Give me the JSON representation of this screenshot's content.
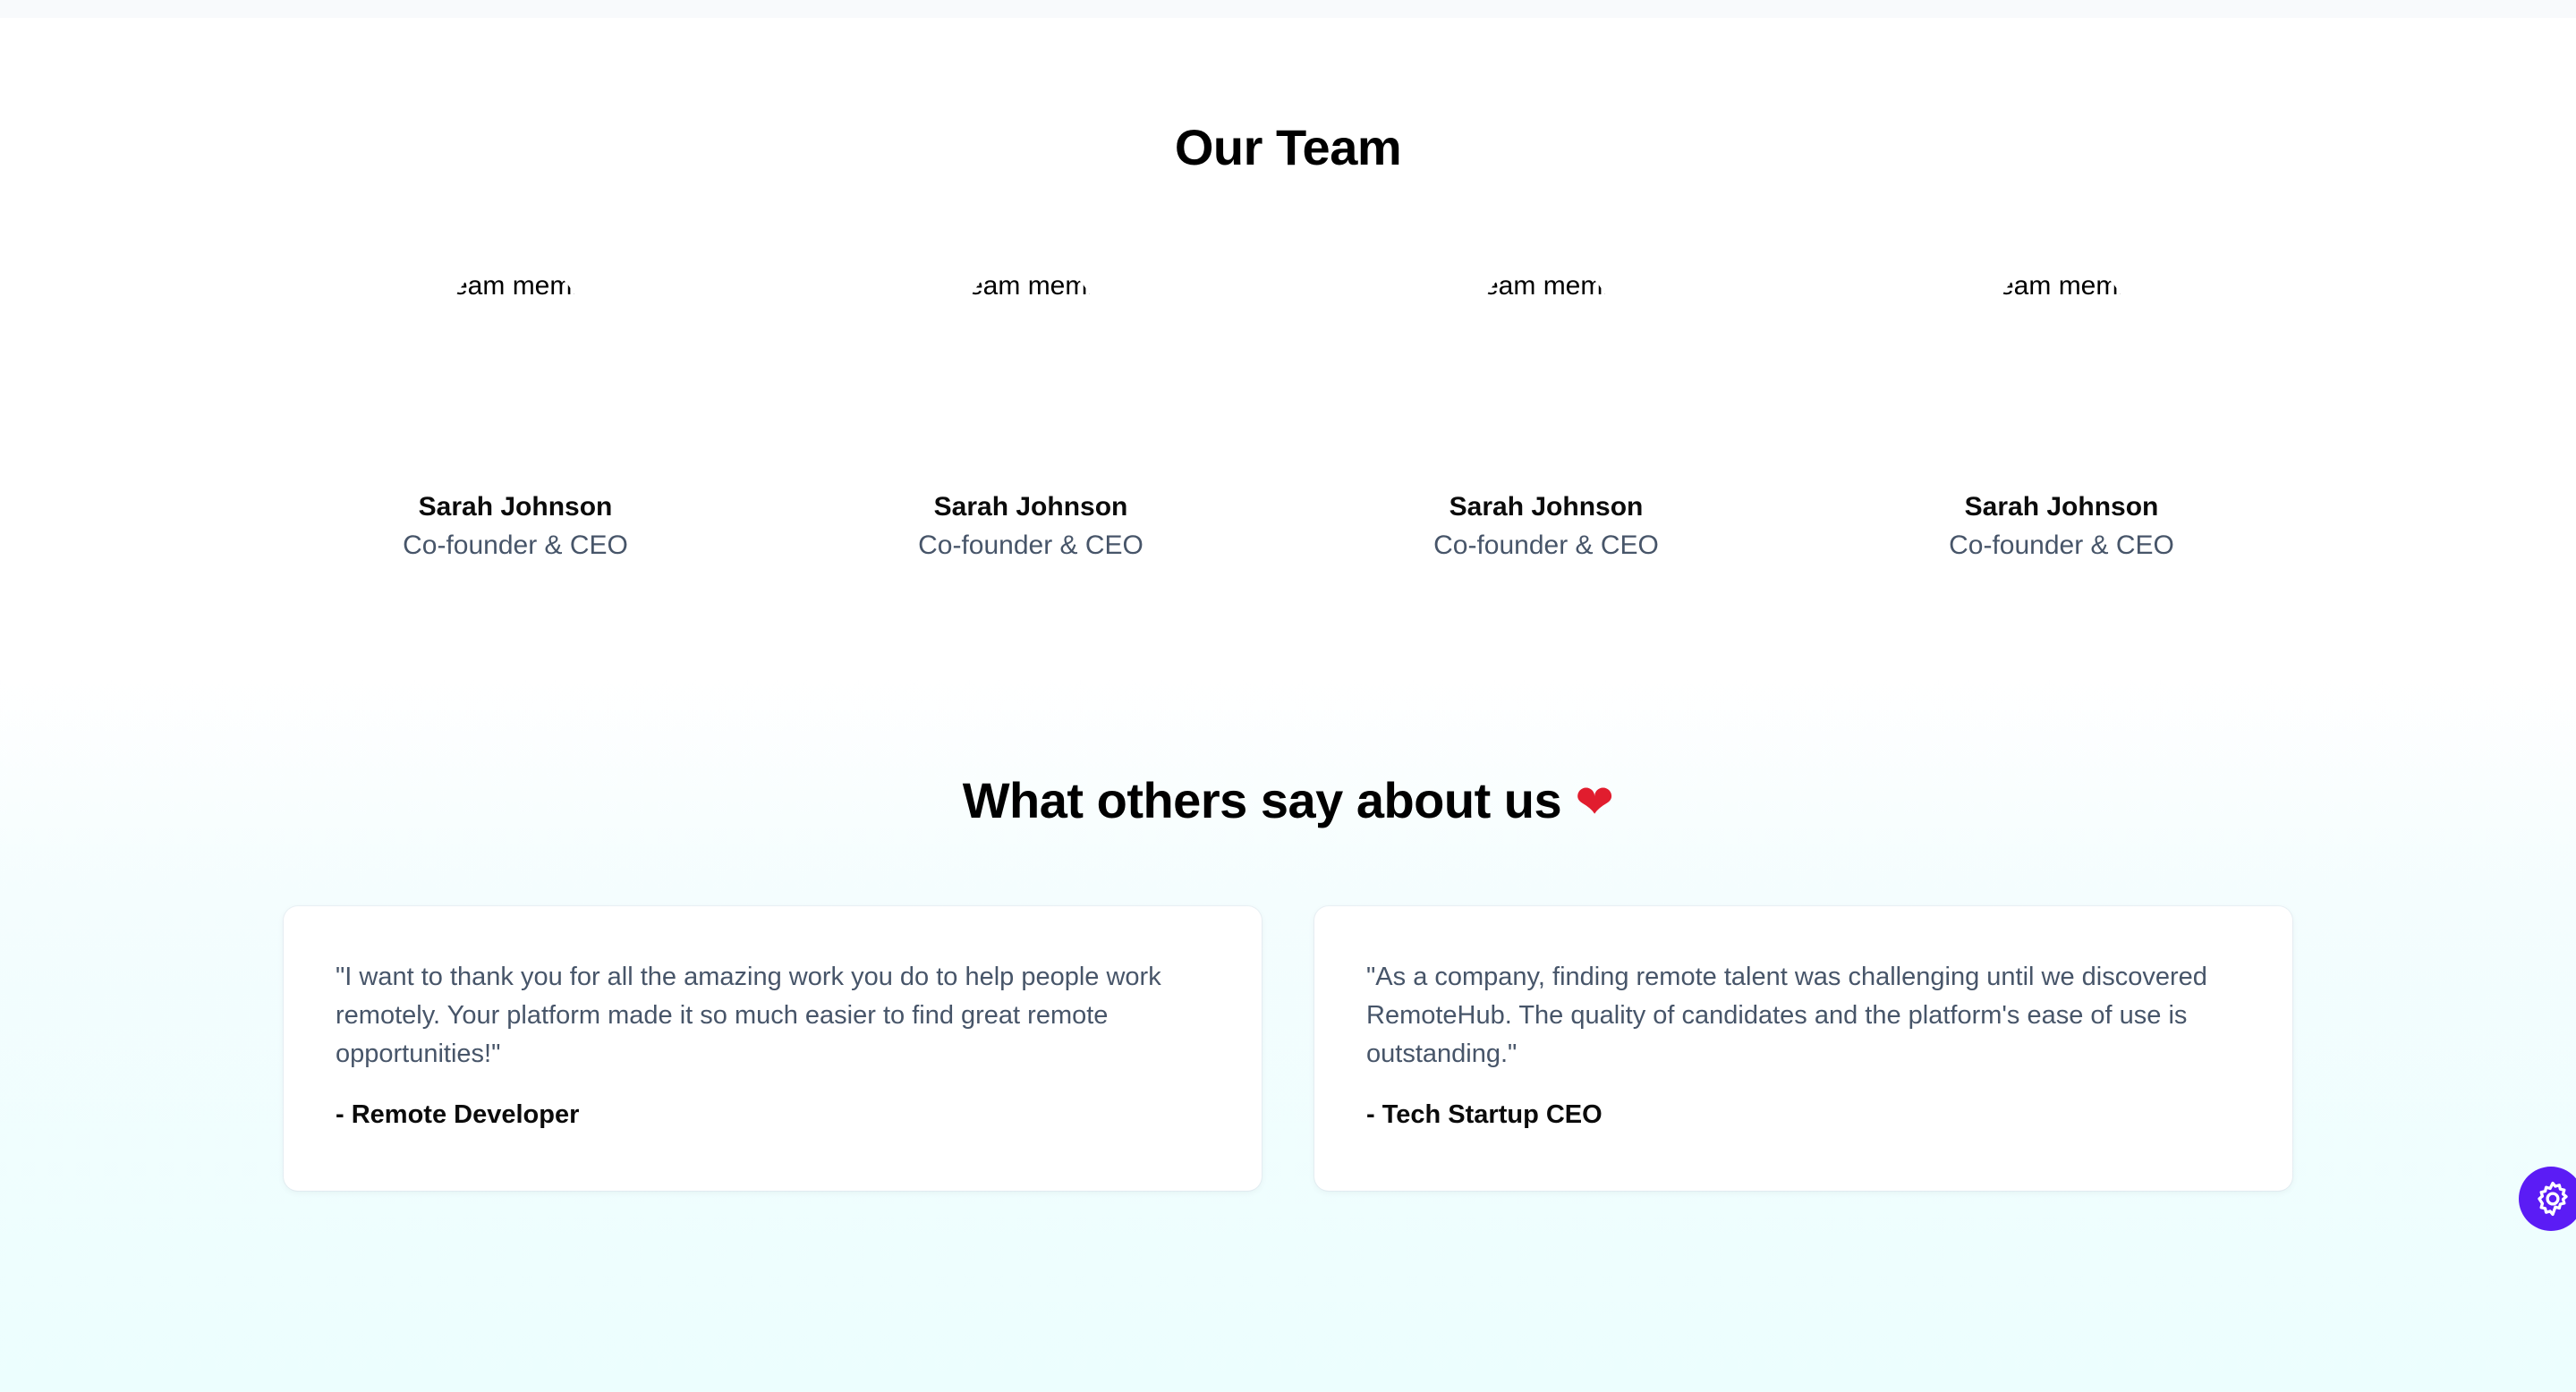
{
  "team": {
    "title": "Our Team",
    "members": [
      {
        "photo_alt": "Team member",
        "name": "Sarah Johnson",
        "role": "Co-founder & CEO"
      },
      {
        "photo_alt": "Team member",
        "name": "Sarah Johnson",
        "role": "Co-founder & CEO"
      },
      {
        "photo_alt": "Team member",
        "name": "Sarah Johnson",
        "role": "Co-founder & CEO"
      },
      {
        "photo_alt": "Team member",
        "name": "Sarah Johnson",
        "role": "Co-founder & CEO"
      }
    ]
  },
  "testimonials": {
    "title": "What others say about us",
    "title_emoji": "❤",
    "items": [
      {
        "quote": "\"I want to thank you for all the amazing work you do to help people work remotely. Your platform made it so much easier to find great remote opportunities!\"",
        "author": "- Remote Developer"
      },
      {
        "quote": "\"As a company, finding remote talent was challenging until we discovered RemoteHub. The quality of candidates and the platform's ease of use is outstanding.\"",
        "author": "- Tech Startup CEO"
      }
    ]
  },
  "settings_button": {
    "icon": "gear-icon",
    "color": "#5b1cf5"
  }
}
